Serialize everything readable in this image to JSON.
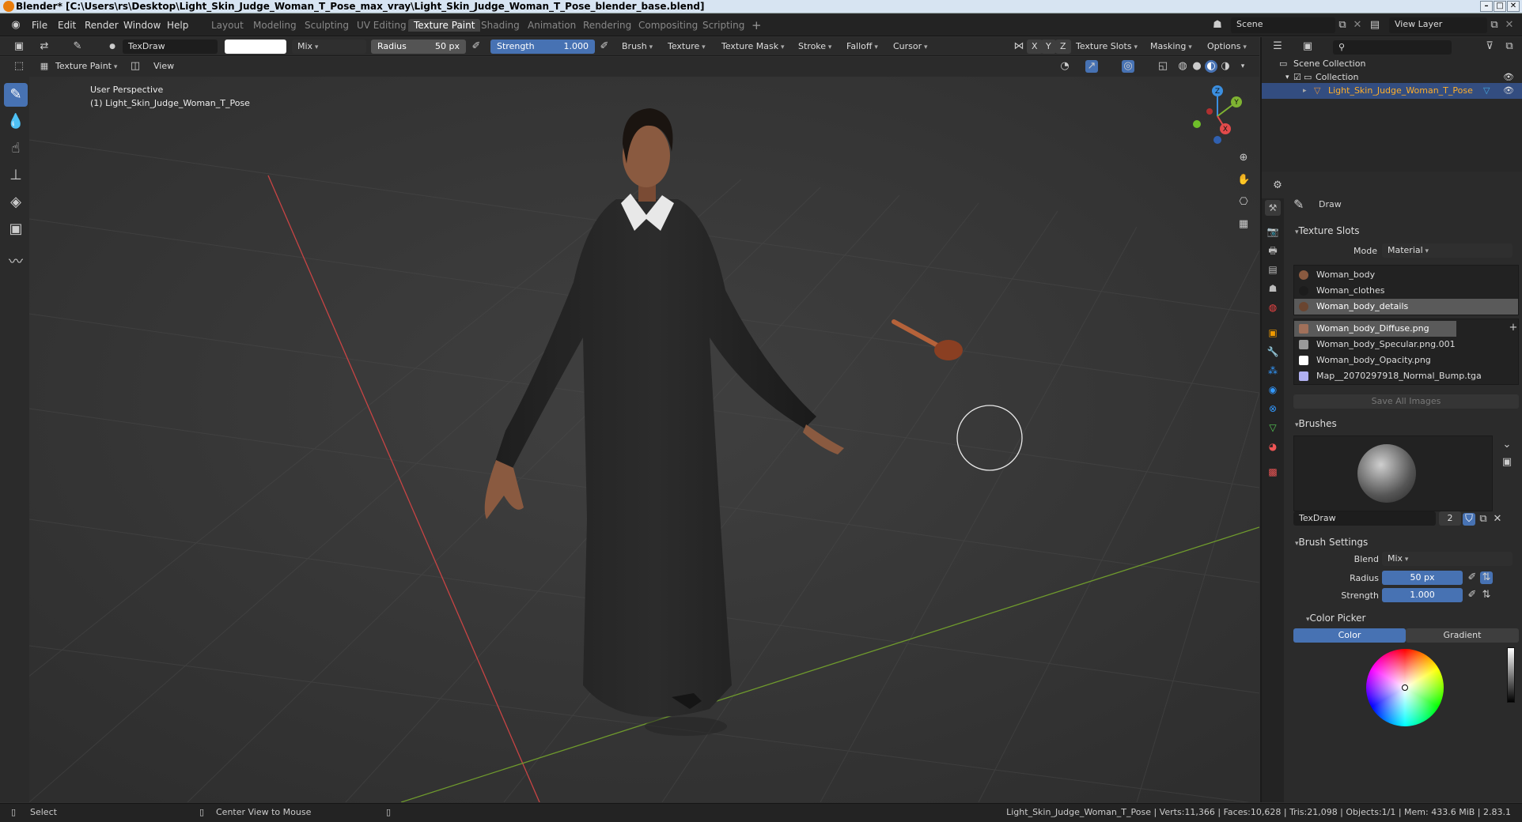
{
  "title": "Blender* [C:\\Users\\rs\\Desktop\\Light_Skin_Judge_Woman_T_Pose_max_vray\\Light_Skin_Judge_Woman_T_Pose_blender_base.blend]",
  "menu": [
    "File",
    "Edit",
    "Render",
    "Window",
    "Help"
  ],
  "workspaces": [
    "Layout",
    "Modeling",
    "Sculpting",
    "UV Editing",
    "Texture Paint",
    "Shading",
    "Animation",
    "Rendering",
    "Compositing",
    "Scripting"
  ],
  "active_workspace": "Texture Paint",
  "scene": "Scene",
  "view_layer": "View Layer",
  "tool_header": {
    "brush_name": "TexDraw",
    "blend": "Mix",
    "radius_label": "Radius",
    "radius_value": "50 px",
    "strength_label": "Strength",
    "strength_value": "1.000",
    "menus": [
      "Brush",
      "Texture",
      "Texture Mask",
      "Stroke",
      "Falloff",
      "Cursor"
    ],
    "axes": [
      "X",
      "Y",
      "Z"
    ],
    "right_menus": [
      "Texture Slots",
      "Masking",
      "Options"
    ]
  },
  "view_header": {
    "mode": "Texture Paint",
    "view": "View"
  },
  "viewport": {
    "perspective": "User Perspective",
    "object": "(1) Light_Skin_Judge_Woman_T_Pose",
    "gizmo_axes": [
      "X",
      "Y",
      "Z"
    ]
  },
  "outliner": {
    "scene_collection": "Scene Collection",
    "collection": "Collection",
    "object": "Light_Skin_Judge_Woman_T_Pose"
  },
  "properties": {
    "tool_name": "Draw",
    "texture_slots": {
      "header": "Texture Slots",
      "mode_label": "Mode",
      "mode_value": "Material",
      "materials": [
        {
          "name": "Woman_body",
          "color": "#8a5a40",
          "selected": false
        },
        {
          "name": "Woman_clothes",
          "color": "#1c1c1c",
          "selected": false
        },
        {
          "name": "Woman_body_details",
          "color": "#6a4530",
          "selected": true
        }
      ],
      "images": [
        {
          "name": "Woman_body_Diffuse.png",
          "color": "#a0705a",
          "selected": true
        },
        {
          "name": "Woman_body_Specular.png.001",
          "color": "#9a9a9a",
          "selected": false
        },
        {
          "name": "Woman_body_Opacity.png",
          "color": "#ffffff",
          "selected": false
        },
        {
          "name": "Map__2070297918_Normal_Bump.tga",
          "color": "#b0b0f0",
          "selected": false
        }
      ],
      "save_all": "Save All Images"
    },
    "brushes": {
      "header": "Brushes",
      "brush_name": "TexDraw",
      "users": "2"
    },
    "brush_settings": {
      "header": "Brush Settings",
      "blend_label": "Blend",
      "blend_value": "Mix",
      "radius_label": "Radius",
      "radius_value": "50 px",
      "strength_label": "Strength",
      "strength_value": "1.000"
    },
    "color_picker": {
      "header": "Color Picker",
      "tabs": [
        "Color",
        "Gradient"
      ]
    }
  },
  "status": {
    "select": "Select",
    "center_view": "Center View to Mouse",
    "info": "Light_Skin_Judge_Woman_T_Pose | Verts:11,366 | Faces:10,628 | Tris:21,098 | Objects:1/1 | Mem: 433.6 MiB | 2.83.1"
  },
  "colors": {
    "accent": "#4772b3",
    "x_axis": "#e24a4a",
    "y_axis": "#7fb332",
    "z_axis": "#3b8fe0"
  }
}
